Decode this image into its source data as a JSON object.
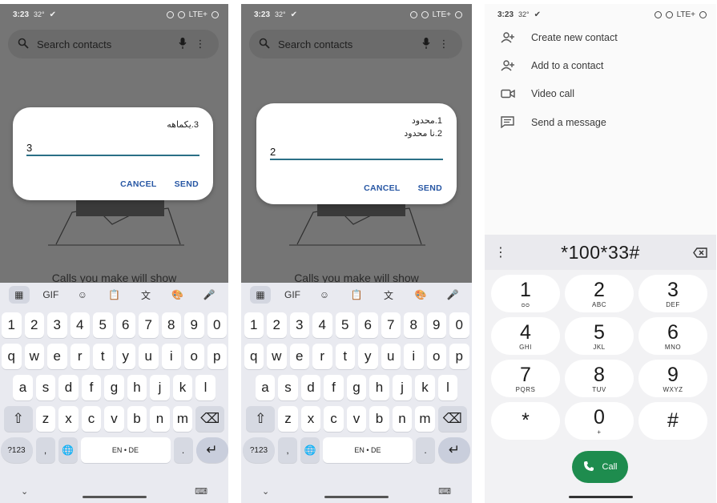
{
  "status": {
    "time": "3:23",
    "temp": "32°",
    "network": "LTE+"
  },
  "colors": {
    "accent_teal": "#2b6f86",
    "button_blue": "#2857a4",
    "call_green": "#1e8c4e",
    "dim_overlay": "#757575"
  },
  "contacts_app": {
    "search_placeholder": "Search contacts",
    "empty_text": "Calls you make will show"
  },
  "dialog1": {
    "message": "3.یکماهه",
    "input_value": "3",
    "cancel_label": "CANCEL",
    "send_label": "SEND"
  },
  "dialog2": {
    "message_line1": "1.محدود",
    "message_line2": "2.نا محدود",
    "input_value": "2",
    "cancel_label": "CANCEL",
    "send_label": "SEND"
  },
  "keyboard": {
    "toolbar": {
      "gif": "GIF"
    },
    "row_numbers": [
      "1",
      "2",
      "3",
      "4",
      "5",
      "6",
      "7",
      "8",
      "9",
      "0"
    ],
    "row_1": [
      "q",
      "w",
      "e",
      "r",
      "t",
      "y",
      "u",
      "i",
      "o",
      "p"
    ],
    "row_2": [
      "a",
      "s",
      "d",
      "f",
      "g",
      "h",
      "j",
      "k",
      "l"
    ],
    "row_3": [
      "z",
      "x",
      "c",
      "v",
      "b",
      "n",
      "m"
    ],
    "symbols_key": "?123",
    "comma_key": ",",
    "space_label": "EN • DE",
    "period_key": "."
  },
  "dialer": {
    "menu": {
      "create_contact": "Create new contact",
      "add_to_contact": "Add to a contact",
      "video_call": "Video call",
      "send_message": "Send a message"
    },
    "entered_number": "*100*33#",
    "keys": [
      {
        "digit": "1",
        "letters": ""
      },
      {
        "digit": "2",
        "letters": "ABC"
      },
      {
        "digit": "3",
        "letters": "DEF"
      },
      {
        "digit": "4",
        "letters": "GHI"
      },
      {
        "digit": "5",
        "letters": "JKL"
      },
      {
        "digit": "6",
        "letters": "MNO"
      },
      {
        "digit": "7",
        "letters": "PQRS"
      },
      {
        "digit": "8",
        "letters": "TUV"
      },
      {
        "digit": "9",
        "letters": "WXYZ"
      },
      {
        "digit": "*",
        "letters": ""
      },
      {
        "digit": "0",
        "letters": "+"
      },
      {
        "digit": "#",
        "letters": ""
      }
    ],
    "call_label": "Call"
  }
}
